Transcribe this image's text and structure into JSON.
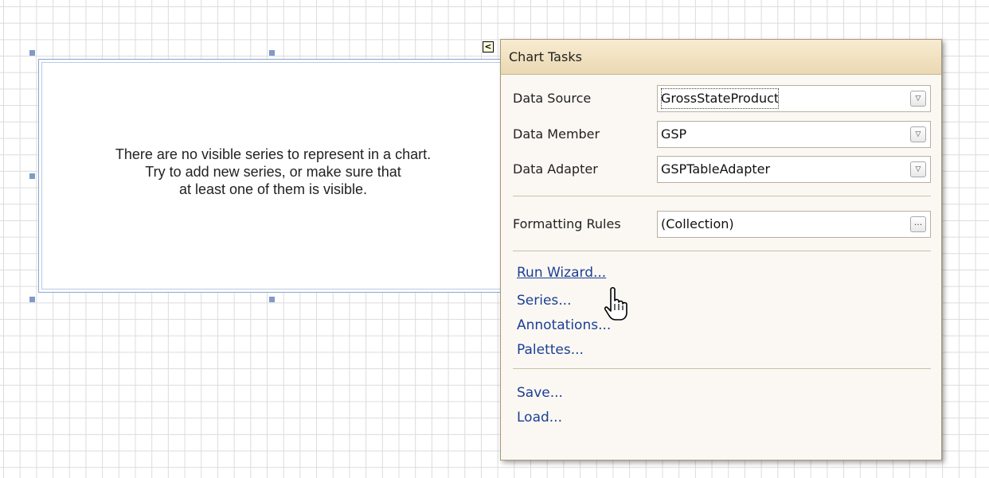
{
  "chart_control": {
    "message_lines": [
      "There are no visible series to represent in a chart.",
      "Try to add new series, or make sure that",
      "at least one of them is visible."
    ]
  },
  "smart_tag": {
    "glyph": "<"
  },
  "panel": {
    "title": "Chart Tasks",
    "data_source": {
      "label": "Data Source",
      "value": "GrossStateProduct"
    },
    "data_member": {
      "label": "Data Member",
      "value": "GSP"
    },
    "data_adapter": {
      "label": "Data Adapter",
      "value": "GSPTableAdapter"
    },
    "formatting_rules": {
      "label": "Formatting Rules",
      "value": "(Collection)",
      "button": "..."
    },
    "links": {
      "run_wizard": "Run Wizard...",
      "series": "Series...",
      "annotations": "Annotations...",
      "palettes": "Palettes...",
      "save": "Save...",
      "load": "Load..."
    }
  },
  "icons": {
    "dropdown": "chevron-down-icon",
    "ellipsis": "ellipsis-icon",
    "cursor": "hand-pointer-icon"
  },
  "colors": {
    "link": "#1c3f95",
    "panel_header": "#ead8b2",
    "selection_border": "#8aa4cf"
  }
}
